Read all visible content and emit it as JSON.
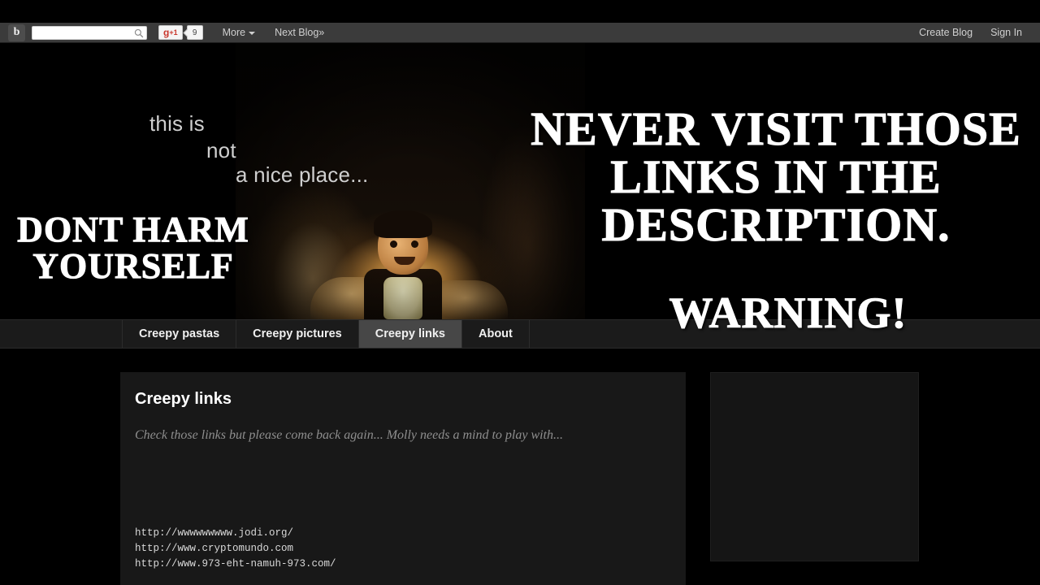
{
  "navbar": {
    "logo_icon": "blogger-b-icon",
    "search": {
      "value": "",
      "placeholder": "",
      "icon": "search-icon"
    },
    "gplus": {
      "label": "g",
      "sup": "+1",
      "count": "9"
    },
    "more_label": "More",
    "next_blog_label": "Next Blog»",
    "create_blog_label": "Create Blog",
    "sign_in_label": "Sign In"
  },
  "banner": {
    "header_lines": [
      "this is",
      "not",
      "a nice place..."
    ],
    "overlay_left": "DONT HARM YOURSELF",
    "overlay_right": "NEVER VISIT THOSE LINKS IN THE DESCRIPTION.",
    "overlay_warning": "WARNING!"
  },
  "tabs": [
    {
      "label": "Creepy pastas",
      "active": false
    },
    {
      "label": "Creepy pictures",
      "active": false
    },
    {
      "label": "Creepy links",
      "active": true
    },
    {
      "label": "About",
      "active": false
    }
  ],
  "post": {
    "title": "Creepy links",
    "subtitle": "Check those links but please come back again... Molly needs a mind to play with...",
    "links": [
      "http://wwwwwwwww.jodi.org/",
      "http://www.cryptomundo.com",
      "http://www.973-eht-namuh-973.com/"
    ]
  },
  "colors": {
    "page_background": "#000000",
    "navbar_background": "#3b3b3b",
    "tabbar_background": "#1b1b1b",
    "tab_active_background": "#474747",
    "panel_background": "#181818",
    "sidebar_background": "#151515",
    "subtitle_text": "#8e8e8e",
    "gplus_red": "#c9362c"
  }
}
